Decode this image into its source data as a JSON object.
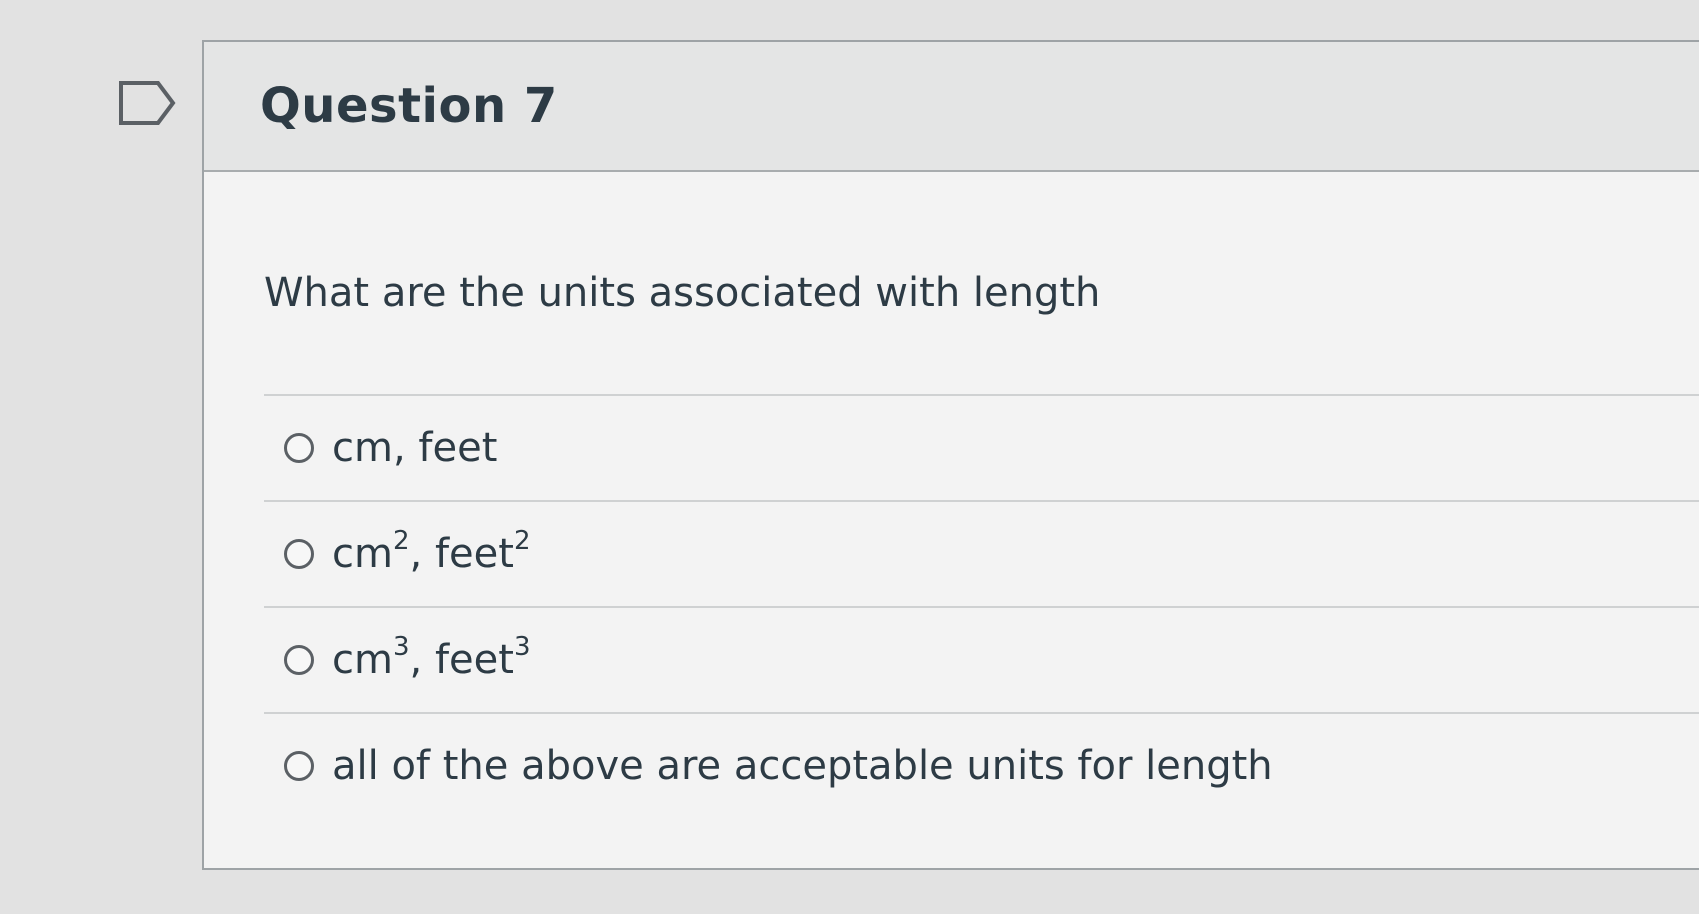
{
  "question": {
    "title": "Question 7",
    "text": "What are the units associated with length"
  },
  "answers": [
    {
      "parts": {
        "a": "cm",
        "b": ", feet"
      },
      "superscript": ""
    },
    {
      "parts": {
        "a": "cm",
        "sup1": "2",
        "b": ", feet",
        "sup2": "2"
      }
    },
    {
      "parts": {
        "a": "cm",
        "sup1": "3",
        "b": ", feet",
        "sup2": "3"
      }
    },
    {
      "parts": {
        "a": "all of the above are acceptable units for length"
      }
    }
  ],
  "icons": {
    "flag": "flag-question-icon",
    "radio": "radio-unchecked-icon"
  },
  "colors": {
    "page_background": "#e2e2e2",
    "card_background": "#f3f3f3",
    "header_background": "#e4e5e5",
    "text": "#2d3b45",
    "border": "#9ea3a6"
  }
}
